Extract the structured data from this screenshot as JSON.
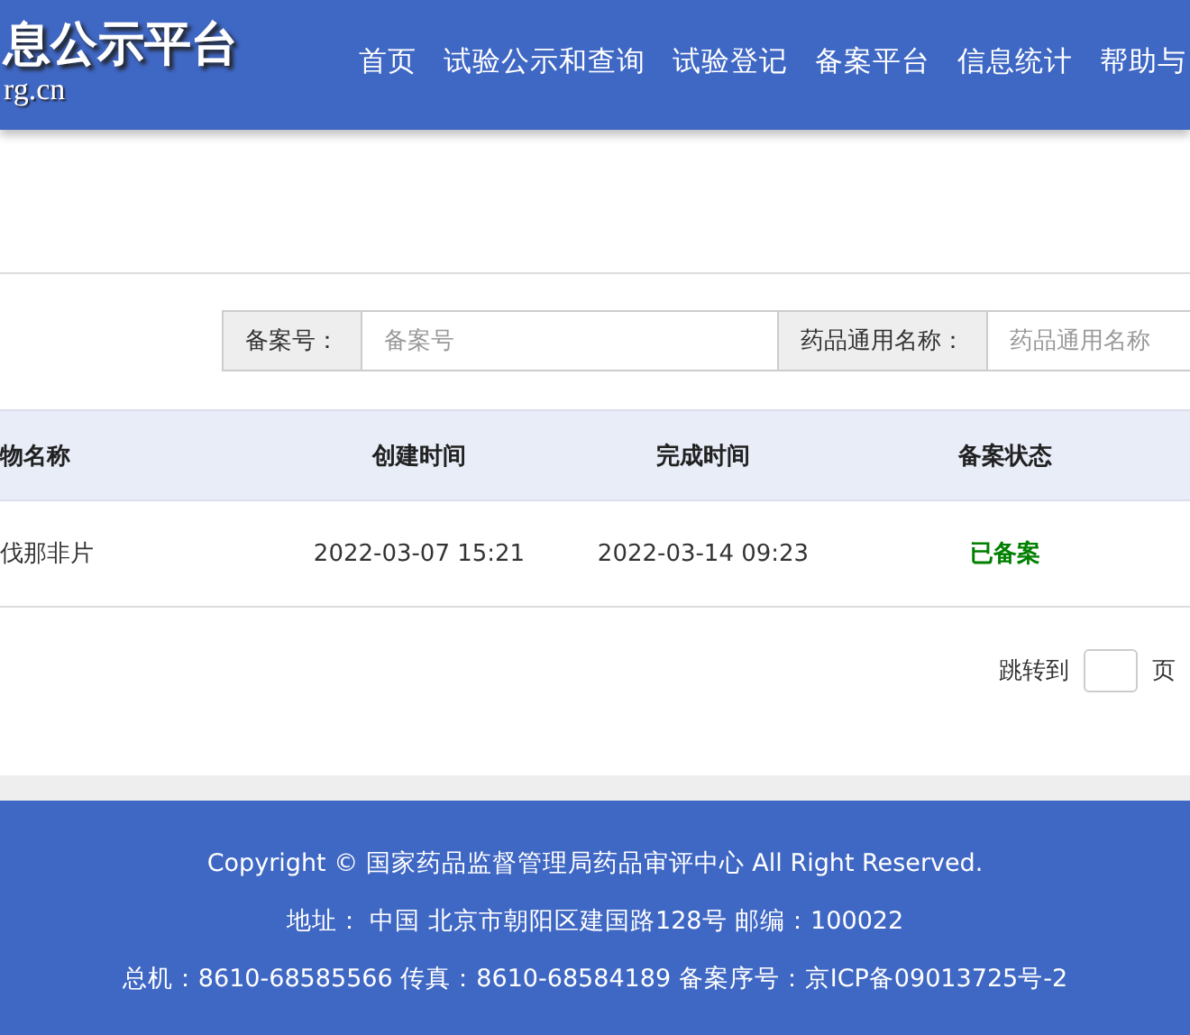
{
  "header": {
    "title": "息公示平台",
    "subtitle": "rg.cn",
    "nav": [
      {
        "label": "首页"
      },
      {
        "label": "试验公示和查询"
      },
      {
        "label": "试验登记"
      },
      {
        "label": "备案平台"
      },
      {
        "label": "信息统计"
      },
      {
        "label": "帮助与"
      }
    ]
  },
  "search": [
    {
      "label": "备案号：",
      "placeholder": "备案号"
    },
    {
      "label": "药品通用名称：",
      "placeholder": "药品通用名称"
    }
  ],
  "table": {
    "columns": [
      "物名称",
      "创建时间",
      "完成时间",
      "备案状态"
    ],
    "rows": [
      {
        "name": "伐那非片",
        "created": "2022-03-07 15:21",
        "finished": "2022-03-14 09:23",
        "status": "已备案",
        "color": "#008000"
      }
    ]
  },
  "pagination": {
    "before": "跳转到",
    "after": "页"
  },
  "footer": [
    "Copyright © 国家药品监督管理局药品审评中心 All Right Reserved.",
    "地址： 中国 北京市朝阳区建国路128号 邮编：100022",
    "总机：8610-68585566 传真：8610-68584189 备案序号：京ICP备09013725号-2"
  ]
}
